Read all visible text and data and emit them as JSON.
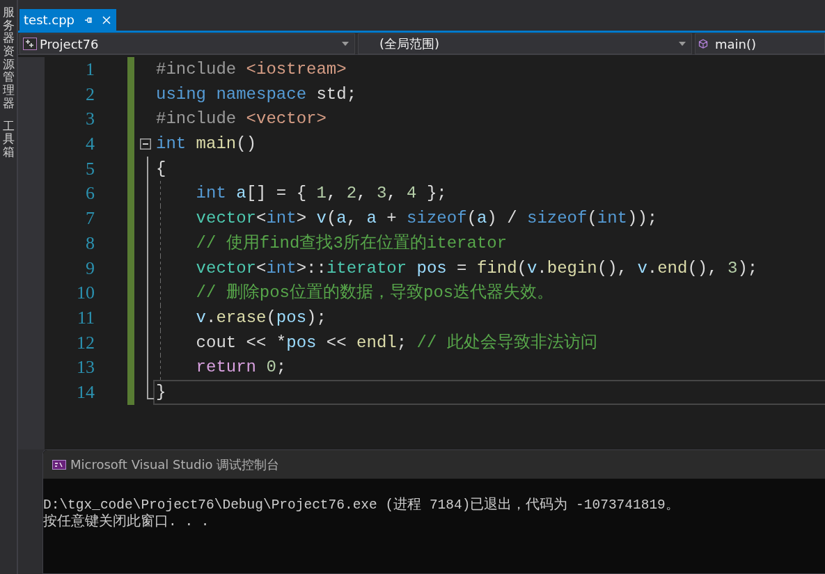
{
  "side_tabs": [
    {
      "label": "服务器资源管理器"
    },
    {
      "label": "工具箱"
    }
  ],
  "tabs": [
    {
      "label": "test.cpp",
      "selected": true
    }
  ],
  "nav": {
    "project": "Project76",
    "scope": "(全局范围)",
    "member": "main()"
  },
  "editor": {
    "lines": [
      {
        "number": "1",
        "kind": "plain",
        "changed": true,
        "guide": false,
        "current": false,
        "tokens": [
          {
            "t": "#include",
            "kind": "pre"
          },
          {
            "t": " <iostream>",
            "kind": "str"
          }
        ]
      },
      {
        "number": "2",
        "kind": "plain",
        "changed": true,
        "guide": false,
        "current": false,
        "tokens": [
          {
            "t": "using namespace",
            "kind": "kw"
          },
          {
            "t": " std;",
            "kind": "plain"
          }
        ]
      },
      {
        "number": "3",
        "kind": "plain",
        "changed": true,
        "guide": false,
        "current": false,
        "tokens": [
          {
            "t": "#include",
            "kind": "pre"
          },
          {
            "t": " <vector>",
            "kind": "str"
          }
        ]
      },
      {
        "number": "4",
        "kind": "foldstart",
        "changed": true,
        "guide": false,
        "current": false,
        "tokens": [
          {
            "t": "int",
            "kind": "kw"
          },
          {
            "t": " main",
            "kind": "fn"
          },
          {
            "t": "()",
            "kind": "plain"
          }
        ]
      },
      {
        "number": "5",
        "kind": "foldbody",
        "changed": true,
        "guide": false,
        "current": false,
        "tokens": [
          {
            "t": "{",
            "kind": "plain"
          }
        ]
      },
      {
        "number": "6",
        "kind": "foldbody",
        "changed": true,
        "guide": true,
        "current": false,
        "tokens": [
          {
            "t": "int",
            "kind": "kw"
          },
          {
            "t": " a",
            "kind": "var"
          },
          {
            "t": "[] = {",
            "kind": "plain"
          },
          {
            "t": " 1",
            "kind": "num"
          },
          {
            "t": ",",
            "kind": "plain"
          },
          {
            "t": " 2",
            "kind": "num"
          },
          {
            "t": ",",
            "kind": "plain"
          },
          {
            "t": " 3",
            "kind": "num"
          },
          {
            "t": ",",
            "kind": "plain"
          },
          {
            "t": " 4",
            "kind": "num"
          },
          {
            "t": " };",
            "kind": "plain"
          }
        ]
      },
      {
        "number": "7",
        "kind": "foldbody",
        "changed": true,
        "guide": true,
        "current": false,
        "tokens": [
          {
            "t": "vector",
            "kind": "type"
          },
          {
            "t": "<",
            "kind": "plain"
          },
          {
            "t": "int",
            "kind": "kw"
          },
          {
            "t": ">",
            "kind": "plain"
          },
          {
            "t": " v",
            "kind": "var"
          },
          {
            "t": "(",
            "kind": "plain"
          },
          {
            "t": "a",
            "kind": "var"
          },
          {
            "t": ",",
            "kind": "plain"
          },
          {
            "t": " a",
            "kind": "var"
          },
          {
            "t": " +",
            "kind": "plain"
          },
          {
            "t": " sizeof",
            "kind": "kw"
          },
          {
            "t": "(",
            "kind": "plain"
          },
          {
            "t": "a",
            "kind": "var"
          },
          {
            "t": ") /",
            "kind": "plain"
          },
          {
            "t": " sizeof",
            "kind": "kw"
          },
          {
            "t": "(",
            "kind": "plain"
          },
          {
            "t": "int",
            "kind": "kw"
          },
          {
            "t": "));",
            "kind": "plain"
          }
        ]
      },
      {
        "number": "8",
        "kind": "foldbody",
        "changed": true,
        "guide": true,
        "current": false,
        "tokens": [
          {
            "t": "// 使用find查找3所在位置的iterator",
            "kind": "cmt"
          }
        ]
      },
      {
        "number": "9",
        "kind": "foldbody",
        "changed": true,
        "guide": true,
        "current": false,
        "tokens": [
          {
            "t": "vector",
            "kind": "type"
          },
          {
            "t": "<",
            "kind": "plain"
          },
          {
            "t": "int",
            "kind": "kw"
          },
          {
            "t": ">::",
            "kind": "plain"
          },
          {
            "t": "iterator",
            "kind": "type"
          },
          {
            "t": " pos",
            "kind": "var"
          },
          {
            "t": " =",
            "kind": "plain"
          },
          {
            "t": " find",
            "kind": "fn"
          },
          {
            "t": "(",
            "kind": "plain"
          },
          {
            "t": "v",
            "kind": "var"
          },
          {
            "t": ".",
            "kind": "plain"
          },
          {
            "t": "begin",
            "kind": "fn"
          },
          {
            "t": "(),",
            "kind": "plain"
          },
          {
            "t": " v",
            "kind": "var"
          },
          {
            "t": ".",
            "kind": "plain"
          },
          {
            "t": "end",
            "kind": "fn"
          },
          {
            "t": "(),",
            "kind": "plain"
          },
          {
            "t": " 3",
            "kind": "num"
          },
          {
            "t": ");",
            "kind": "plain"
          }
        ]
      },
      {
        "number": "10",
        "kind": "foldbody",
        "changed": true,
        "guide": true,
        "current": false,
        "tokens": [
          {
            "t": "// 删除pos位置的数据，导致pos迭代器失效。",
            "kind": "cmt"
          }
        ]
      },
      {
        "number": "11",
        "kind": "foldbody",
        "changed": true,
        "guide": true,
        "current": false,
        "tokens": [
          {
            "t": "v",
            "kind": "var"
          },
          {
            "t": ".",
            "kind": "plain"
          },
          {
            "t": "erase",
            "kind": "fn"
          },
          {
            "t": "(",
            "kind": "plain"
          },
          {
            "t": "pos",
            "kind": "var"
          },
          {
            "t": ");",
            "kind": "plain"
          }
        ]
      },
      {
        "number": "12",
        "kind": "foldbody",
        "changed": true,
        "guide": true,
        "current": false,
        "tokens": [
          {
            "t": "cout << *",
            "kind": "plain"
          },
          {
            "t": "pos",
            "kind": "var"
          },
          {
            "t": " <<",
            "kind": "plain"
          },
          {
            "t": " endl",
            "kind": "fn"
          },
          {
            "t": ";",
            "kind": "plain"
          },
          {
            "t": " // 此处会导致非法访问",
            "kind": "cmt"
          }
        ]
      },
      {
        "number": "13",
        "kind": "foldbody",
        "changed": true,
        "guide": true,
        "current": false,
        "tokens": [
          {
            "t": "return",
            "kind": "ctl"
          },
          {
            "t": " 0",
            "kind": "num"
          },
          {
            "t": ";",
            "kind": "plain"
          }
        ]
      },
      {
        "number": "14",
        "kind": "foldend",
        "changed": true,
        "guide": false,
        "current": true,
        "tokens": [
          {
            "t": "}",
            "kind": "plain"
          }
        ]
      }
    ]
  },
  "console": {
    "title": "Microsoft Visual Studio 调试控制台",
    "lines": [
      "D:\\tgx_code\\Project76\\Debug\\Project76.exe (进程 7184)已退出，代码为 -1073741819。",
      "按任意键关闭此窗口. . ."
    ]
  }
}
